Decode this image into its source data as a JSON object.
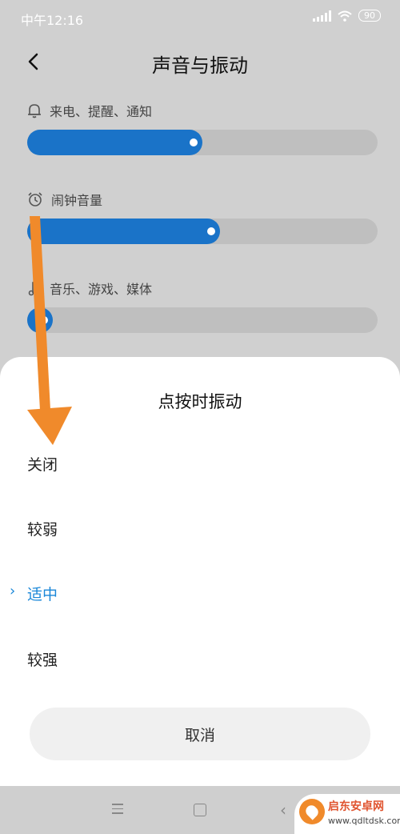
{
  "status_bar": {
    "time": "中午12:16",
    "battery": "90"
  },
  "header": {
    "title": "声音与振动"
  },
  "volumes": [
    {
      "label": "来电、提醒、通知",
      "icon": "bell-icon",
      "level": 0.5
    },
    {
      "label": "闹钟音量",
      "icon": "alarm-clock-icon",
      "level": 0.55
    },
    {
      "label": "音乐、游戏、媒体",
      "icon": "music-note-icon",
      "level": 0.02
    }
  ],
  "sheet": {
    "title": "点按时振动",
    "options": [
      "关闭",
      "较弱",
      "适中",
      "较强"
    ],
    "selected_index": 2,
    "selected_mark": "›",
    "cancel": "取消"
  },
  "navbar": {
    "icons": [
      "menu-icon",
      "home-icon",
      "back-icon"
    ]
  },
  "watermark": {
    "name": "启东安卓网",
    "url": "www.qdltdsk.com"
  },
  "colors": {
    "accent": "#1a73c8",
    "selected": "#1a87d8",
    "arrow": "#f08a2b"
  }
}
